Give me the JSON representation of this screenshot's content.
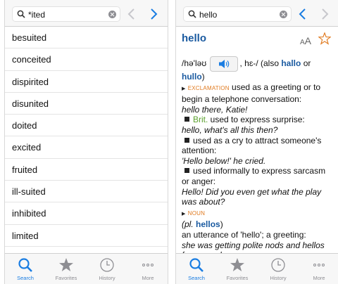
{
  "left": {
    "search": {
      "query": "*ited"
    },
    "words": [
      "besuited",
      "conceited",
      "dispirited",
      "disunited",
      "doited",
      "excited",
      "fruited",
      "ill-suited",
      "inhibited",
      "limited"
    ]
  },
  "right": {
    "search": {
      "query": "hello"
    },
    "headword": "hello",
    "text_size_small": "A",
    "text_size_large": "A",
    "pron_open": "/hə'ləʊ",
    "pron_mid": ", hɛ-/ (also ",
    "alt1": "hallo",
    "or": " or",
    "alt2": "hullo",
    "close_paren": ")",
    "exclamation_label": "EXCLAMATION",
    "sense1": " used as a greeting or to begin a telephone conversation:",
    "example1": "hello there, Katie!",
    "brit": "Brit.",
    "sense2": " used to express surprise:",
    "example2": "hello, what's all this then?",
    "sense3": "used as a cry to attract someone's attention:",
    "example3": "'Hello below!' he cried.",
    "sense4": "used informally to express sarcasm or anger:",
    "example4": "Hello! Did you even get what the play was about?",
    "noun_label": "NOUN",
    "plural_open": "(pl. ",
    "plural_word": "hellos",
    "plural_close": ")",
    "noun_sense": "an utterance of 'hello'; a greeting:",
    "noun_example": "she was getting polite nods and hellos from people."
  },
  "tabs": {
    "search": "Search",
    "favorites": "Favorites",
    "history": "History",
    "more": "More"
  },
  "colors": {
    "accent": "#1a7de2",
    "link": "#1a5aa0",
    "label": "#e07a1f",
    "brit": "#5aa02c",
    "inactive": "#8e8e93"
  },
  "icons": [
    "search-icon",
    "clear-icon",
    "back-arrow-icon",
    "forward-arrow-icon",
    "star-icon",
    "clock-icon",
    "more-dots-icon",
    "speaker-icon"
  ]
}
